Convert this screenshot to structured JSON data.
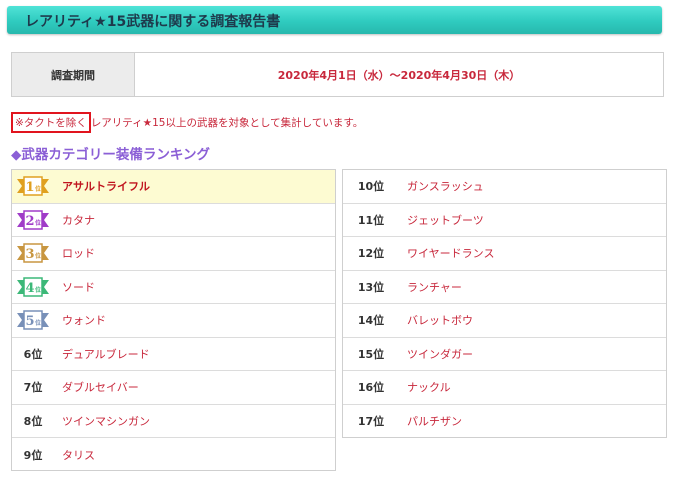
{
  "header": {
    "title": "レアリティ★15武器に関する調査報告書"
  },
  "period": {
    "label": "調査期間",
    "value": "2020年4月1日（水）～2020年4月30日（木）"
  },
  "note": {
    "highlight": "※タクトを除く",
    "text": "レアリティ★15以上の武器を対象として集計しています。"
  },
  "section": {
    "heading": "◆武器カテゴリー装備ランキング"
  },
  "ranking_left": [
    {
      "rank": "1位",
      "weapon": "アサルトライフル",
      "badge_color": "#e0a020",
      "badge_num": "1"
    },
    {
      "rank": "2位",
      "weapon": "カタナ",
      "badge_color": "#a03cc8",
      "badge_num": "2"
    },
    {
      "rank": "3位",
      "weapon": "ロッド",
      "badge_color": "#c89640",
      "badge_num": "3"
    },
    {
      "rank": "4位",
      "weapon": "ソード",
      "badge_color": "#3cb878",
      "badge_num": "4"
    },
    {
      "rank": "5位",
      "weapon": "ウォンド",
      "badge_color": "#7890b8",
      "badge_num": "5"
    },
    {
      "rank": "6位",
      "weapon": "デュアルブレード"
    },
    {
      "rank": "7位",
      "weapon": "ダブルセイバー"
    },
    {
      "rank": "8位",
      "weapon": "ツインマシンガン"
    },
    {
      "rank": "9位",
      "weapon": "タリス"
    }
  ],
  "ranking_right": [
    {
      "rank": "10位",
      "weapon": "ガンスラッシュ"
    },
    {
      "rank": "11位",
      "weapon": "ジェットブーツ"
    },
    {
      "rank": "12位",
      "weapon": "ワイヤードランス"
    },
    {
      "rank": "13位",
      "weapon": "ランチャー"
    },
    {
      "rank": "14位",
      "weapon": "バレットボウ"
    },
    {
      "rank": "15位",
      "weapon": "ツインダガー"
    },
    {
      "rank": "16位",
      "weapon": "ナックル"
    },
    {
      "rank": "17位",
      "weapon": "パルチザン"
    }
  ],
  "badge_suffix": "位"
}
